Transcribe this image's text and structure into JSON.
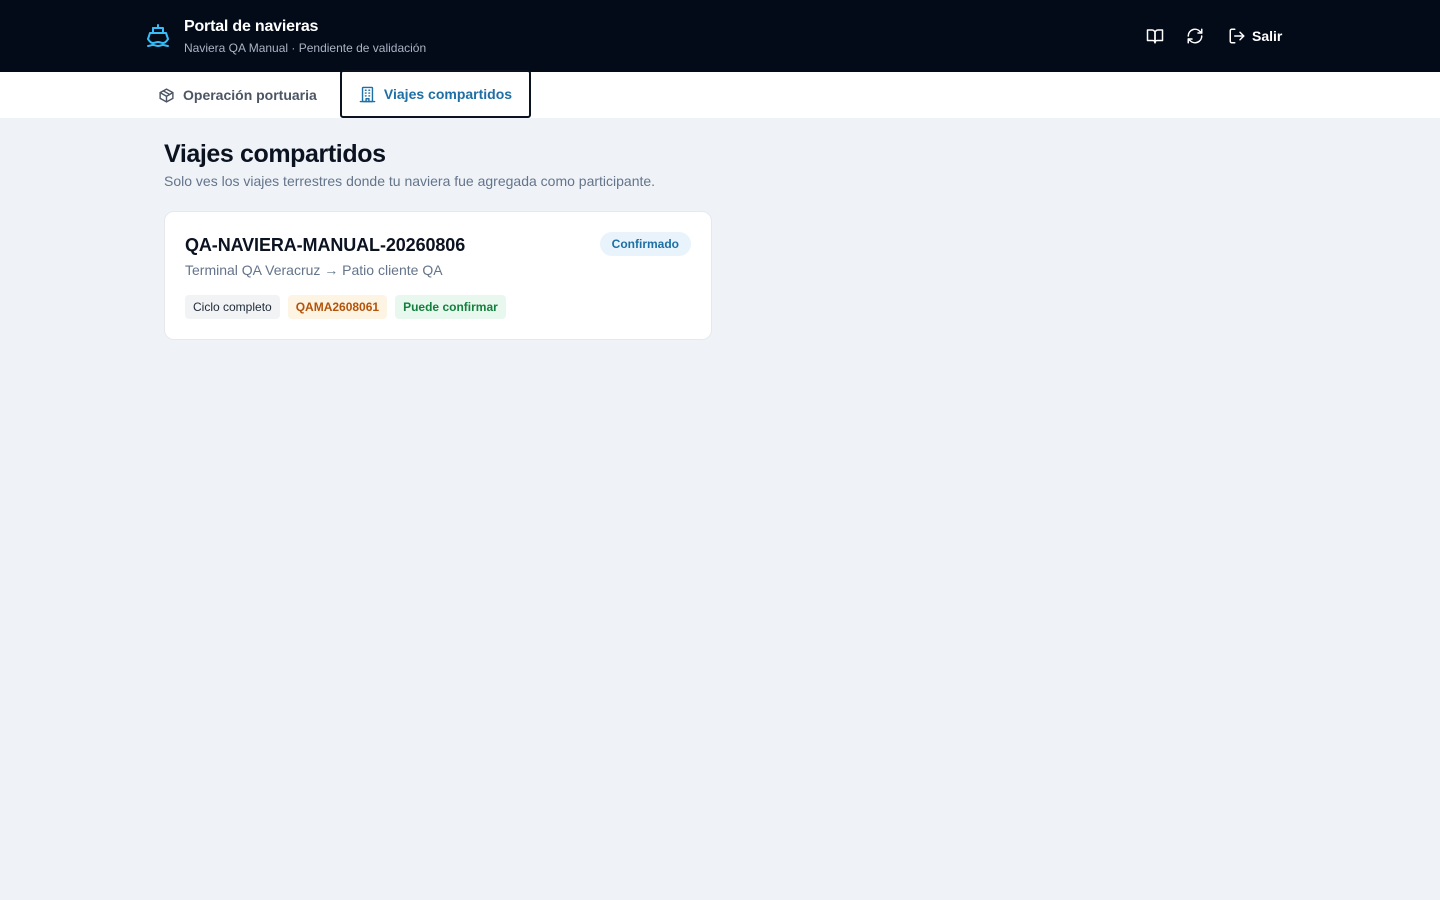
{
  "header": {
    "title": "Portal de navieras",
    "subtitle": "Naviera QA Manual · Pendiente de validación",
    "icons": {
      "brand": "ship-icon",
      "book": "book-open-icon",
      "refresh": "refresh-icon",
      "logout": "logout-icon"
    },
    "logout_label": "Salir"
  },
  "tabs": [
    {
      "label": "Operación portuaria",
      "icon": "package-icon",
      "active": false
    },
    {
      "label": "Viajes compartidos",
      "icon": "building-icon",
      "active": true
    }
  ],
  "page": {
    "title": "Viajes compartidos",
    "subtitle": "Solo ves los viajes terrestres donde tu naviera fue agregada como participante."
  },
  "trips": [
    {
      "code": "QA-NAVIERA-MANUAL-20260806",
      "route": "Terminal QA Veracruz → Patio cliente QA",
      "status": "Confirmado",
      "tags": [
        "Ciclo completo",
        "QAMA2608061",
        "Puede confirmar"
      ]
    }
  ],
  "colors": {
    "topbar": "#030a18",
    "accent": "#1d6fa5",
    "background": "#eff3f7",
    "brand_icon": "#38bdf8",
    "status_bg": "#e8f3fb",
    "container_tag": "#b45309",
    "confirm_tag": "#15803d"
  }
}
